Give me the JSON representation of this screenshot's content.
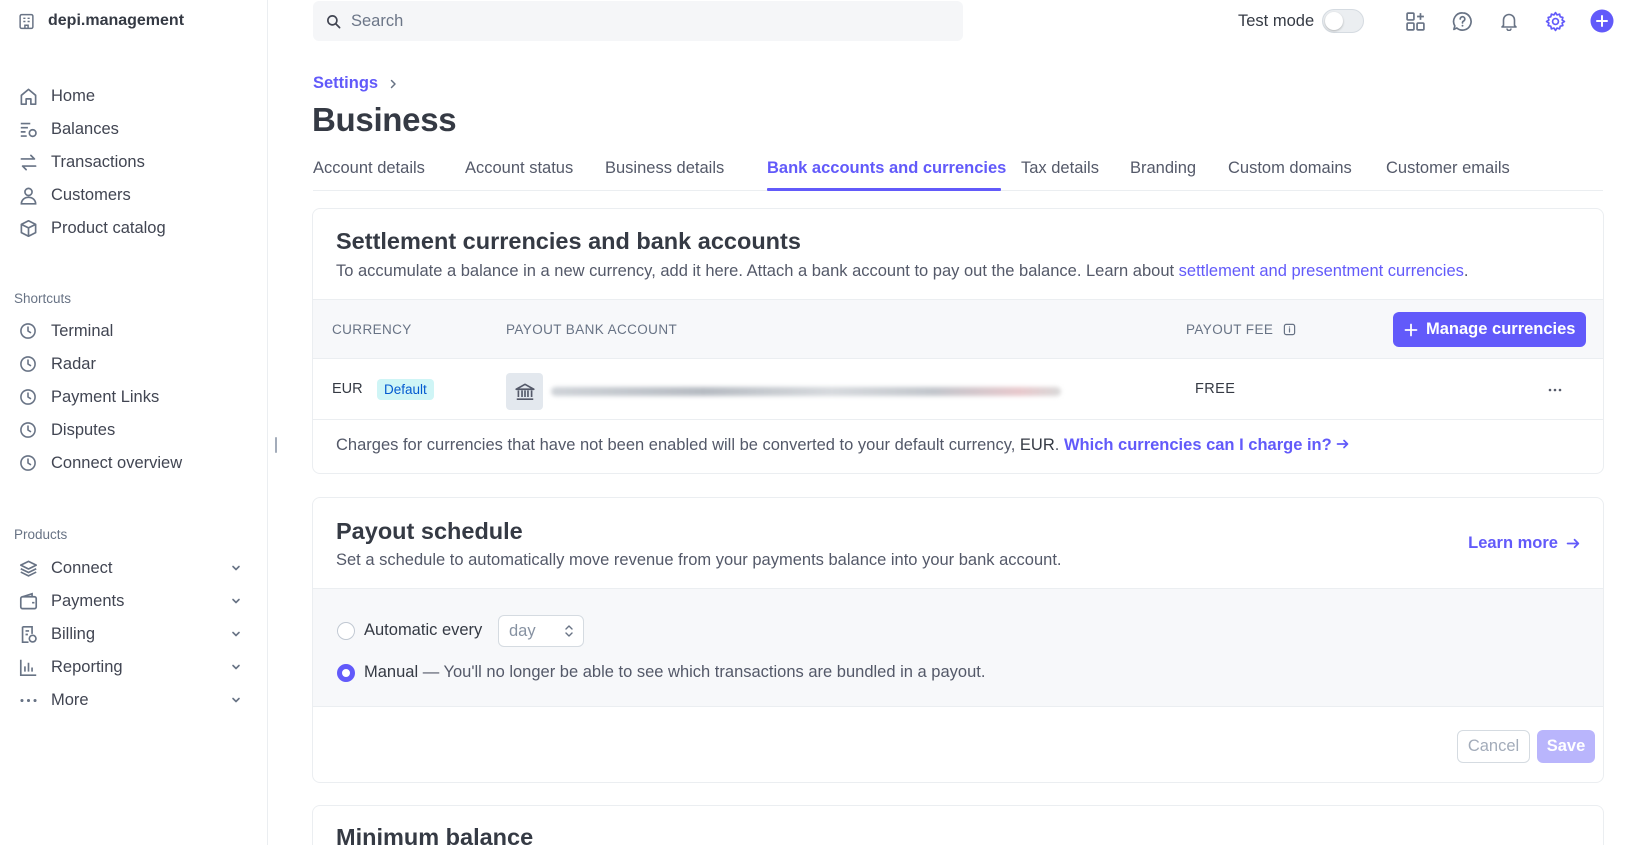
{
  "account": {
    "name": "depi.management"
  },
  "nav": {
    "main": [
      {
        "label": "Home",
        "icon": "home-icon"
      },
      {
        "label": "Balances",
        "icon": "balances-icon"
      },
      {
        "label": "Transactions",
        "icon": "transactions-icon"
      },
      {
        "label": "Customers",
        "icon": "customers-icon"
      },
      {
        "label": "Product catalog",
        "icon": "product-catalog-icon"
      }
    ],
    "shortcuts_label": "Shortcuts",
    "shortcuts": [
      {
        "label": "Terminal",
        "icon": "clock-icon"
      },
      {
        "label": "Radar",
        "icon": "clock-icon"
      },
      {
        "label": "Payment Links",
        "icon": "clock-icon"
      },
      {
        "label": "Disputes",
        "icon": "clock-icon"
      },
      {
        "label": "Connect overview",
        "icon": "clock-icon"
      }
    ],
    "products_label": "Products",
    "products": [
      {
        "label": "Connect",
        "icon": "connect-icon"
      },
      {
        "label": "Payments",
        "icon": "payments-icon"
      },
      {
        "label": "Billing",
        "icon": "billing-icon"
      },
      {
        "label": "Reporting",
        "icon": "reporting-icon"
      },
      {
        "label": "More",
        "icon": "more-icon"
      }
    ]
  },
  "topbar": {
    "search_placeholder": "Search",
    "test_mode_label": "Test mode",
    "test_mode_on": false,
    "icons": [
      "apps-icon",
      "help-icon",
      "notifications-icon",
      "settings-icon",
      "create-icon"
    ]
  },
  "breadcrumb": {
    "parent": "Settings"
  },
  "page": {
    "title": "Business"
  },
  "tabs": [
    {
      "label": "Account details",
      "active": false
    },
    {
      "label": "Account status",
      "active": false
    },
    {
      "label": "Business details",
      "active": false
    },
    {
      "label": "Bank accounts and currencies",
      "active": true
    },
    {
      "label": "Tax details",
      "active": false
    },
    {
      "label": "Branding",
      "active": false
    },
    {
      "label": "Custom domains",
      "active": false
    },
    {
      "label": "Customer emails",
      "active": false
    }
  ],
  "settlement": {
    "title": "Settlement currencies and bank accounts",
    "desc_prefix": "To accumulate a balance in a new currency, add it here. Attach a bank account to pay out the balance. Learn about ",
    "desc_link": "settlement and presentment currencies",
    "desc_suffix": ".",
    "columns": {
      "currency": "CURRENCY",
      "bank": "PAYOUT BANK ACCOUNT",
      "fee": "PAYOUT FEE"
    },
    "manage_button": "Manage currencies",
    "rows": [
      {
        "currency": "EUR",
        "badge": "Default",
        "fee": "FREE"
      }
    ],
    "footer_prefix": "Charges for currencies that have not been enabled will be converted to your default currency, ",
    "footer_currency": "EUR",
    "footer_suffix": ".",
    "footer_link": "Which currencies can I charge in?"
  },
  "payout": {
    "title": "Payout schedule",
    "desc": "Set a schedule to automatically move revenue from your payments balance into your bank account.",
    "learn_more": "Learn more",
    "auto_label": "Automatic every",
    "interval_value": "day",
    "manual_label": "Manual",
    "manual_desc": " — You'll no longer be able to see which transactions are bundled in a payout.",
    "selected": "manual",
    "cancel": "Cancel",
    "save": "Save"
  },
  "min_balance": {
    "title": "Minimum balance"
  },
  "colors": {
    "accent": "#625afa",
    "badge_bg": "#cff5f6",
    "badge_text": "#045ad0"
  }
}
